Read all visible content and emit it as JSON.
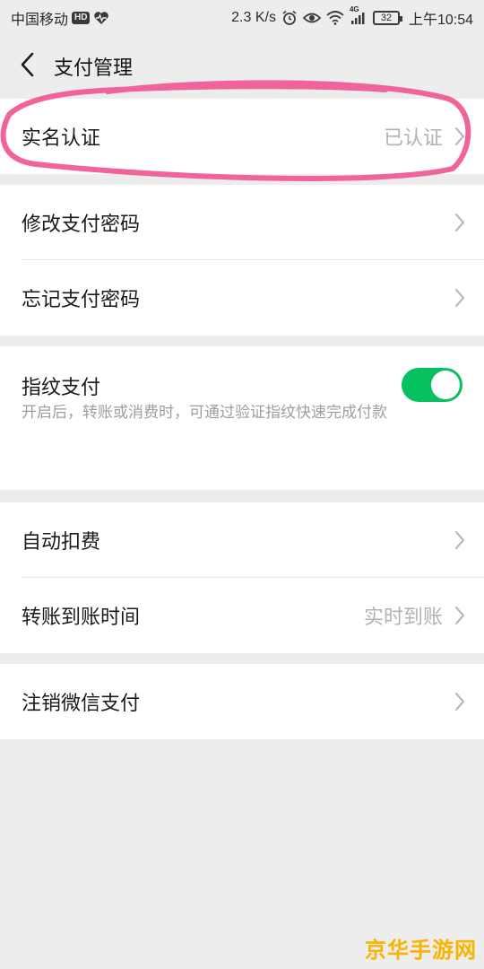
{
  "status_bar": {
    "carrier": "中国移动",
    "hd": "HD",
    "speed": "2.3 K/s",
    "network": "4G",
    "battery": "32",
    "time": "上午10:54"
  },
  "nav": {
    "title": "支付管理"
  },
  "sections": {
    "realname": {
      "label": "实名认证",
      "value": "已认证"
    },
    "change_pwd": {
      "label": "修改支付密码"
    },
    "forgot_pwd": {
      "label": "忘记支付密码"
    },
    "fingerprint": {
      "label": "指纹支付",
      "enabled": true,
      "description": "开启后，转账或消费时，可通过验证指纹快速完成付款"
    },
    "auto_deduct": {
      "label": "自动扣费"
    },
    "transfer_time": {
      "label": "转账到账时间",
      "value": "实时到账"
    },
    "cancel_pay": {
      "label": "注销微信支付"
    }
  },
  "colors": {
    "accent": "#07c160",
    "highlight_stroke": "#f0649b",
    "watermark": "#f7b500"
  },
  "watermark": "京华手游网"
}
